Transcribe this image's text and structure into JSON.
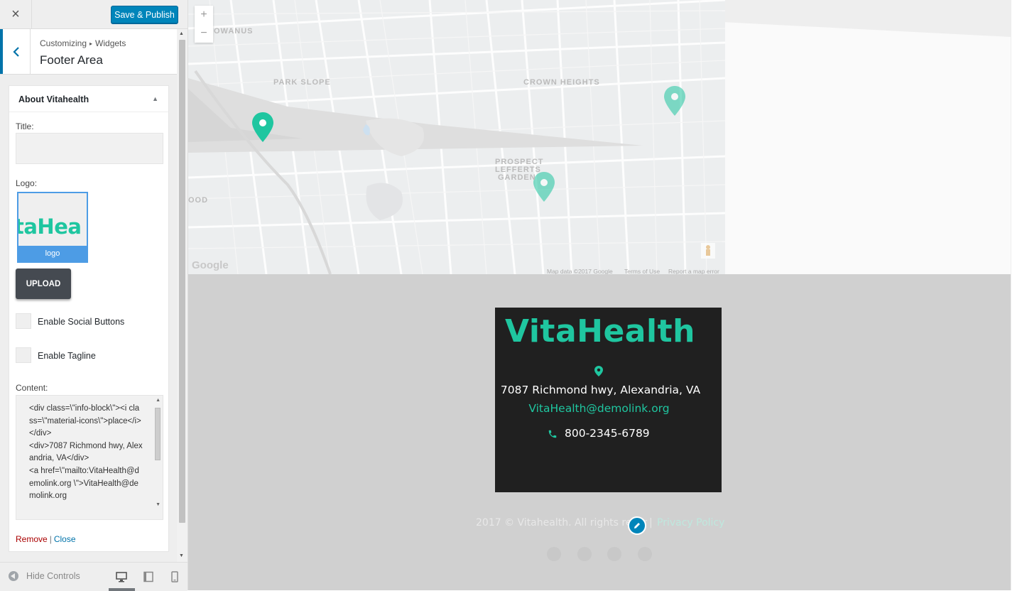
{
  "toolbar": {
    "close_icon": "×",
    "save_label": "Save & Publish"
  },
  "section": {
    "crumb_parent": "Customizing",
    "crumb_child": "Widgets",
    "title": "Footer Area"
  },
  "widget": {
    "title": "About Vitahealth",
    "title_label": "Title:",
    "title_value": "",
    "logo_label": "Logo:",
    "logo_preview_text": "taHea",
    "logo_caption": "logo",
    "upload_label": "UPLOAD",
    "social_label": "Enable Social Buttons",
    "tagline_label": "Enable Tagline",
    "content_label": "Content:",
    "content_value": "<div class=\\\"info-block\\\"><i class=\\\"material-icons\\\">place</i>  </div>\n<div>7087 Richmond hwy, Alexandria, VA</div>\n<a href=\\\"mailto:VitaHealth@demolink.org \\\">VitaHealth@demolink.org",
    "remove_label": "Remove",
    "separator": "|",
    "close_label": "Close"
  },
  "footer_controls": {
    "hide_label": "Hide Controls"
  },
  "map": {
    "labels": [
      "OWANUS",
      "PARK SLOPE",
      "CROWN HEIGHTS",
      "PROSPECT",
      "LEFFERTS",
      "GARDEN",
      "OOD"
    ],
    "attribution": [
      "Map data ©2017 Google",
      "Terms of Use",
      "Report a map error"
    ],
    "google": "Google",
    "zoom_in": "+",
    "zoom_out": "−"
  },
  "site_footer": {
    "brand": "VitaHealth",
    "address": "7087 Richmond hwy, Alexandria, VA",
    "email": "VitaHealth@demolink.org",
    "phone": "800-2345-6789",
    "copyright": "2017 © Vitahealth. All rights reser",
    "divider": "|",
    "privacy": "Privacy Policy"
  },
  "colors": {
    "accent": "#1fc6a0",
    "wp_blue": "#0085ba",
    "card_bg": "#202020",
    "footer_bg": "#d0d0d0"
  }
}
